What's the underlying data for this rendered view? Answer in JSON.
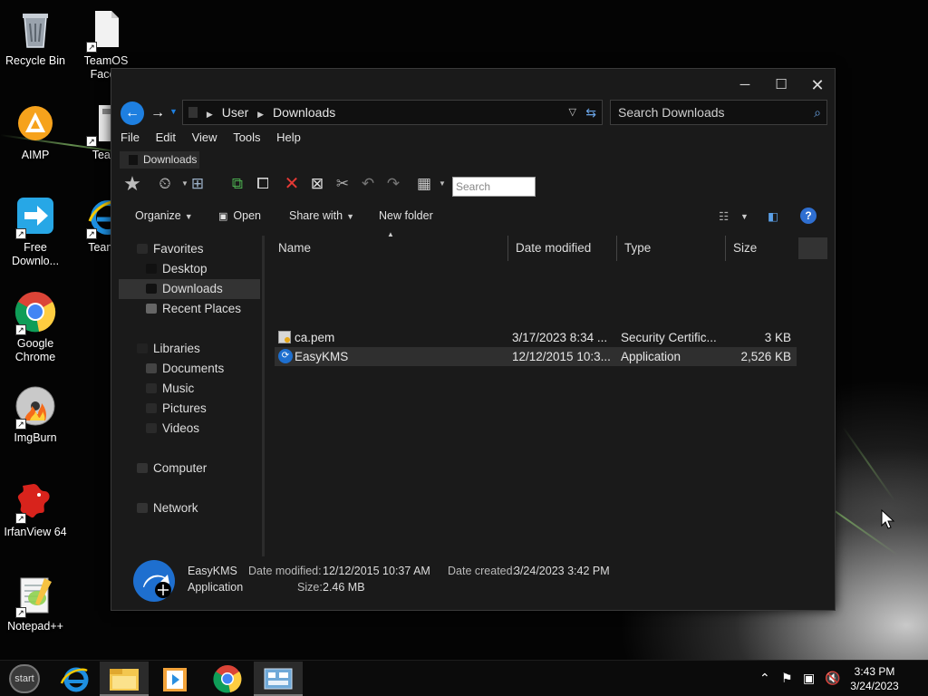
{
  "desktop": {
    "icons": [
      {
        "label": "Recycle Bin"
      },
      {
        "label": "TeamOS Faceb"
      },
      {
        "label": "AIMP"
      },
      {
        "label": "Team"
      },
      {
        "label": "Free Downlo..."
      },
      {
        "label": "TeamC"
      },
      {
        "label": "Google Chrome"
      },
      {
        "label": "ImgBurn"
      },
      {
        "label": "IrfanView 64"
      },
      {
        "label": "Notepad++"
      }
    ]
  },
  "window": {
    "address": {
      "root": "User",
      "current": "Downloads"
    },
    "search_placeholder": "Search Downloads",
    "menu": [
      "File",
      "Edit",
      "View",
      "Tools",
      "Help"
    ],
    "crumb_tab": "Downloads",
    "toolbar_search_placeholder": "Search",
    "commands": {
      "organize": "Organize",
      "open": "Open",
      "share_with": "Share with",
      "new_folder": "New folder"
    },
    "nav": {
      "favorites": "Favorites",
      "desktop": "Desktop",
      "downloads": "Downloads",
      "recent": "Recent Places",
      "libraries": "Libraries",
      "documents": "Documents",
      "music": "Music",
      "pictures": "Pictures",
      "videos": "Videos",
      "computer": "Computer",
      "network": "Network"
    },
    "columns": {
      "name": "Name",
      "date": "Date modified",
      "type": "Type",
      "size": "Size"
    },
    "files": [
      {
        "name": "ca.pem",
        "date": "3/17/2023 8:34 ...",
        "type": "Security Certific...",
        "size": "3 KB"
      },
      {
        "name": "EasyKMS",
        "date": "12/12/2015 10:3...",
        "type": "Application",
        "size": "2,526 KB"
      }
    ],
    "details": {
      "name": "EasyKMS",
      "kind": "Application",
      "modified_label": "Date modified:",
      "modified_value": "12/12/2015 10:37 AM",
      "created_label": "Date created:",
      "created_value": "3/24/2023 3:42 PM",
      "size_label": "Size:",
      "size_value": "2.46 MB"
    }
  },
  "taskbar": {
    "start_label": "start",
    "time": "3:43 PM",
    "date": "3/24/2023"
  },
  "colors": {
    "accent_blue": "#1e7fe0",
    "window_bg": "#1a1a1a",
    "selection": "#2f2f2f"
  }
}
